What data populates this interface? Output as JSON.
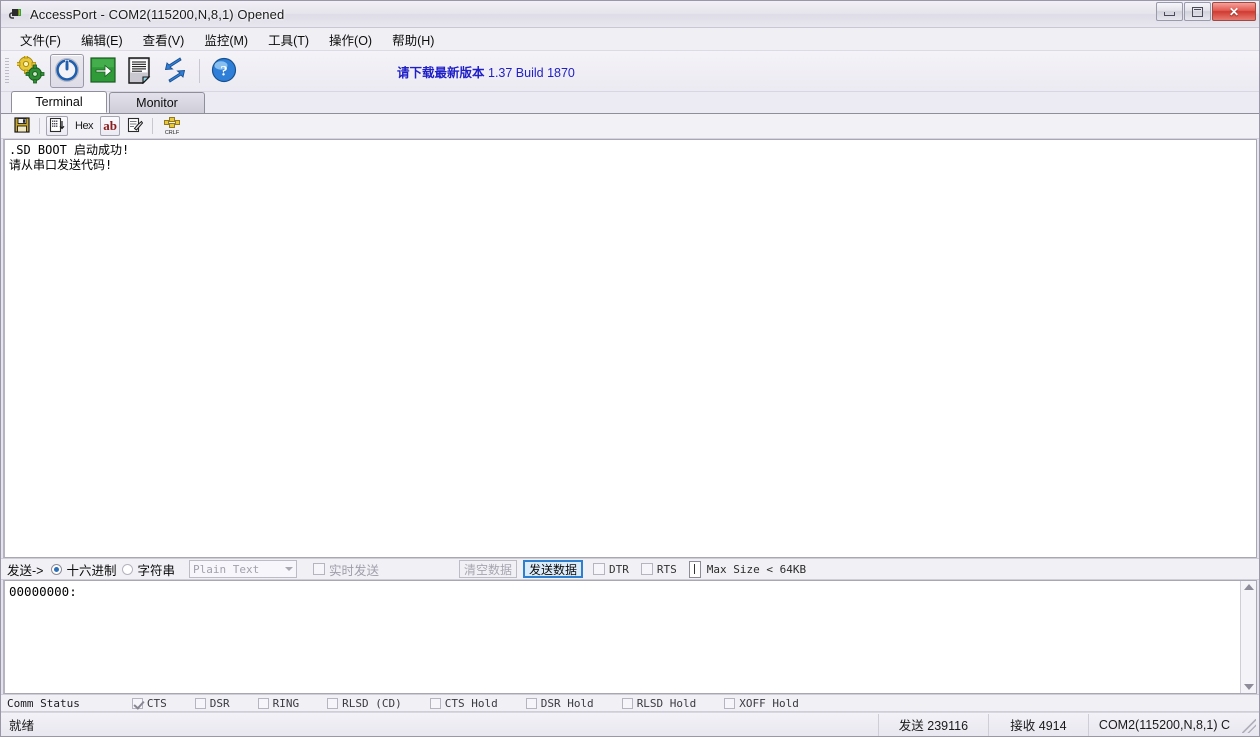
{
  "window": {
    "title": "AccessPort - COM2(115200,N,8,1) Opened",
    "icon": "serial-plug-icon",
    "minimize_label": "Minimize",
    "maximize_label": "Restore",
    "close_label": "✕"
  },
  "menubar": {
    "items": [
      {
        "label": "文件(F)",
        "name": "menu-file"
      },
      {
        "label": "编辑(E)",
        "name": "menu-edit"
      },
      {
        "label": "查看(V)",
        "name": "menu-view"
      },
      {
        "label": "监控(M)",
        "name": "menu-monitor"
      },
      {
        "label": "工具(T)",
        "name": "menu-tools"
      },
      {
        "label": "操作(O)",
        "name": "menu-operation"
      },
      {
        "label": "帮助(H)",
        "name": "menu-help"
      }
    ]
  },
  "toolbar": {
    "buttons": [
      {
        "name": "config-gears-icon",
        "tip": "配置"
      },
      {
        "name": "power-toggle-icon",
        "tip": "打开/关闭串口",
        "pressed": true
      },
      {
        "name": "send-green-arrow-icon",
        "tip": "发送"
      },
      {
        "name": "document-icon",
        "tip": "文档"
      },
      {
        "name": "exchange-arrows-icon",
        "tip": "收发交换"
      },
      {
        "name": "help-question-icon",
        "tip": "帮助"
      }
    ],
    "version_notice": "请下载最新版本",
    "version_number": "1.37 Build 1870",
    "link_color": "#2020c8"
  },
  "tabs": [
    {
      "label": "Terminal",
      "name": "tab-terminal",
      "active": true
    },
    {
      "label": "Monitor",
      "name": "tab-monitor",
      "active": false
    }
  ],
  "terminal_toolbar": {
    "buttons": [
      {
        "name": "save-floppy-icon",
        "label": ""
      },
      {
        "name": "export-list-icon",
        "label": "",
        "framed": true
      },
      {
        "name": "hex-view-button",
        "label": "Hex"
      },
      {
        "name": "ascii-view-button",
        "label": "ab",
        "framed": true,
        "active": true
      },
      {
        "name": "edit-check-icon",
        "label": ""
      },
      {
        "name": "crlf-icon",
        "label": "CRLF"
      }
    ]
  },
  "terminal": {
    "lines": [
      ".SD BOOT 启动成功!",
      "请从串口发送代码!"
    ]
  },
  "sendbar": {
    "label": "发送->",
    "radios": [
      {
        "label": "十六进制",
        "name": "radio-hex",
        "selected": true
      },
      {
        "label": "字符串",
        "name": "radio-string",
        "selected": false
      }
    ],
    "format_combo": {
      "value": "Plain Text",
      "disabled": true
    },
    "realtime_checkbox": {
      "label": "实时发送",
      "checked": false,
      "disabled": true
    },
    "clear_button": {
      "label": "清空数据",
      "disabled": true
    },
    "send_button": {
      "label": "发送数据",
      "focused": true
    },
    "dtr_checkbox": {
      "label": "DTR",
      "checked": false
    },
    "rts_checkbox": {
      "label": "RTS",
      "checked": false
    },
    "max_size": "Max Size < 64KB"
  },
  "hexedit": {
    "lines": [
      "00000000:"
    ]
  },
  "comm_status": {
    "title": "Comm Status",
    "signals": [
      {
        "label": "CTS",
        "checked": true
      },
      {
        "label": "DSR",
        "checked": false
      },
      {
        "label": "RING",
        "checked": false
      },
      {
        "label": "RLSD (CD)",
        "checked": false
      },
      {
        "label": "CTS Hold",
        "checked": false
      },
      {
        "label": "DSR Hold",
        "checked": false
      },
      {
        "label": "RLSD Hold",
        "checked": false
      },
      {
        "label": "XOFF Hold",
        "checked": false
      }
    ]
  },
  "statusbar": {
    "ready": "就绪",
    "tx": "发送 239116",
    "rx": "接收 4914",
    "port": "COM2(115200,N,8,1) C"
  }
}
